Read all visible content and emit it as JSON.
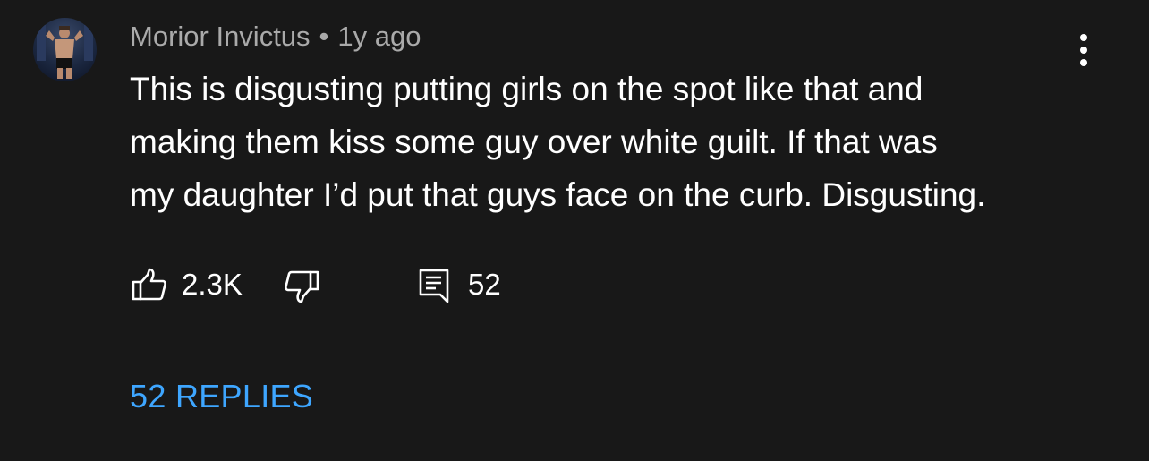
{
  "comment": {
    "author": "Morior Invictus",
    "separator": "•",
    "time": "1y ago",
    "text_lines": [
      "This is disgusting putting girls on the spot like that and",
      "making them kiss some guy over white guilt. If that was",
      "my daughter I’d put that guys face on the curb. Disgusting."
    ],
    "like_count": "2.3K",
    "reply_count": "52",
    "replies_link": "52 REPLIES"
  },
  "icons": {
    "avatar": "avatar",
    "more": "more-vert-icon",
    "like": "thumbs-up-icon",
    "dislike": "thumbs-down-icon",
    "reply": "comment-icon"
  },
  "colors": {
    "background": "#181818",
    "meta_text": "#aaaaaa",
    "body_text": "#ffffff",
    "link": "#3ea6ff"
  }
}
